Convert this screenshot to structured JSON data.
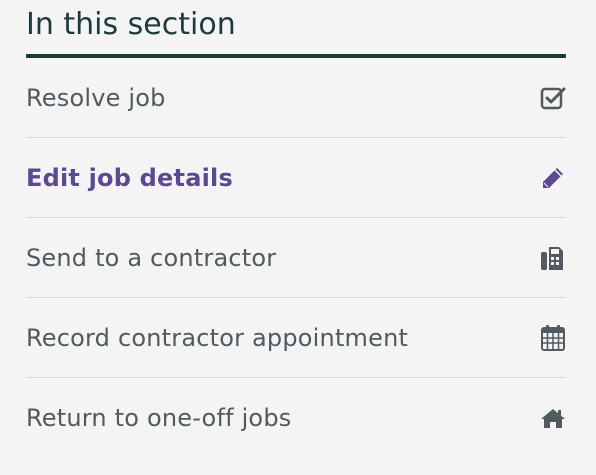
{
  "section": {
    "title": "In this section"
  },
  "nav": {
    "items": [
      {
        "label": "Resolve job",
        "icon": "checkbox-icon",
        "active": false
      },
      {
        "label": "Edit job details",
        "icon": "pencil-icon",
        "active": true
      },
      {
        "label": "Send to a contractor",
        "icon": "fax-icon",
        "active": false
      },
      {
        "label": "Record contractor appointment",
        "icon": "calendar-icon",
        "active": false
      },
      {
        "label": "Return to one-off jobs",
        "icon": "home-icon",
        "active": false
      }
    ]
  },
  "colors": {
    "heading": "#1e3b3c",
    "text": "#505a5f",
    "active": "#5b4a8f",
    "divider": "#d8d8d8",
    "background": "#f4f4f4"
  }
}
